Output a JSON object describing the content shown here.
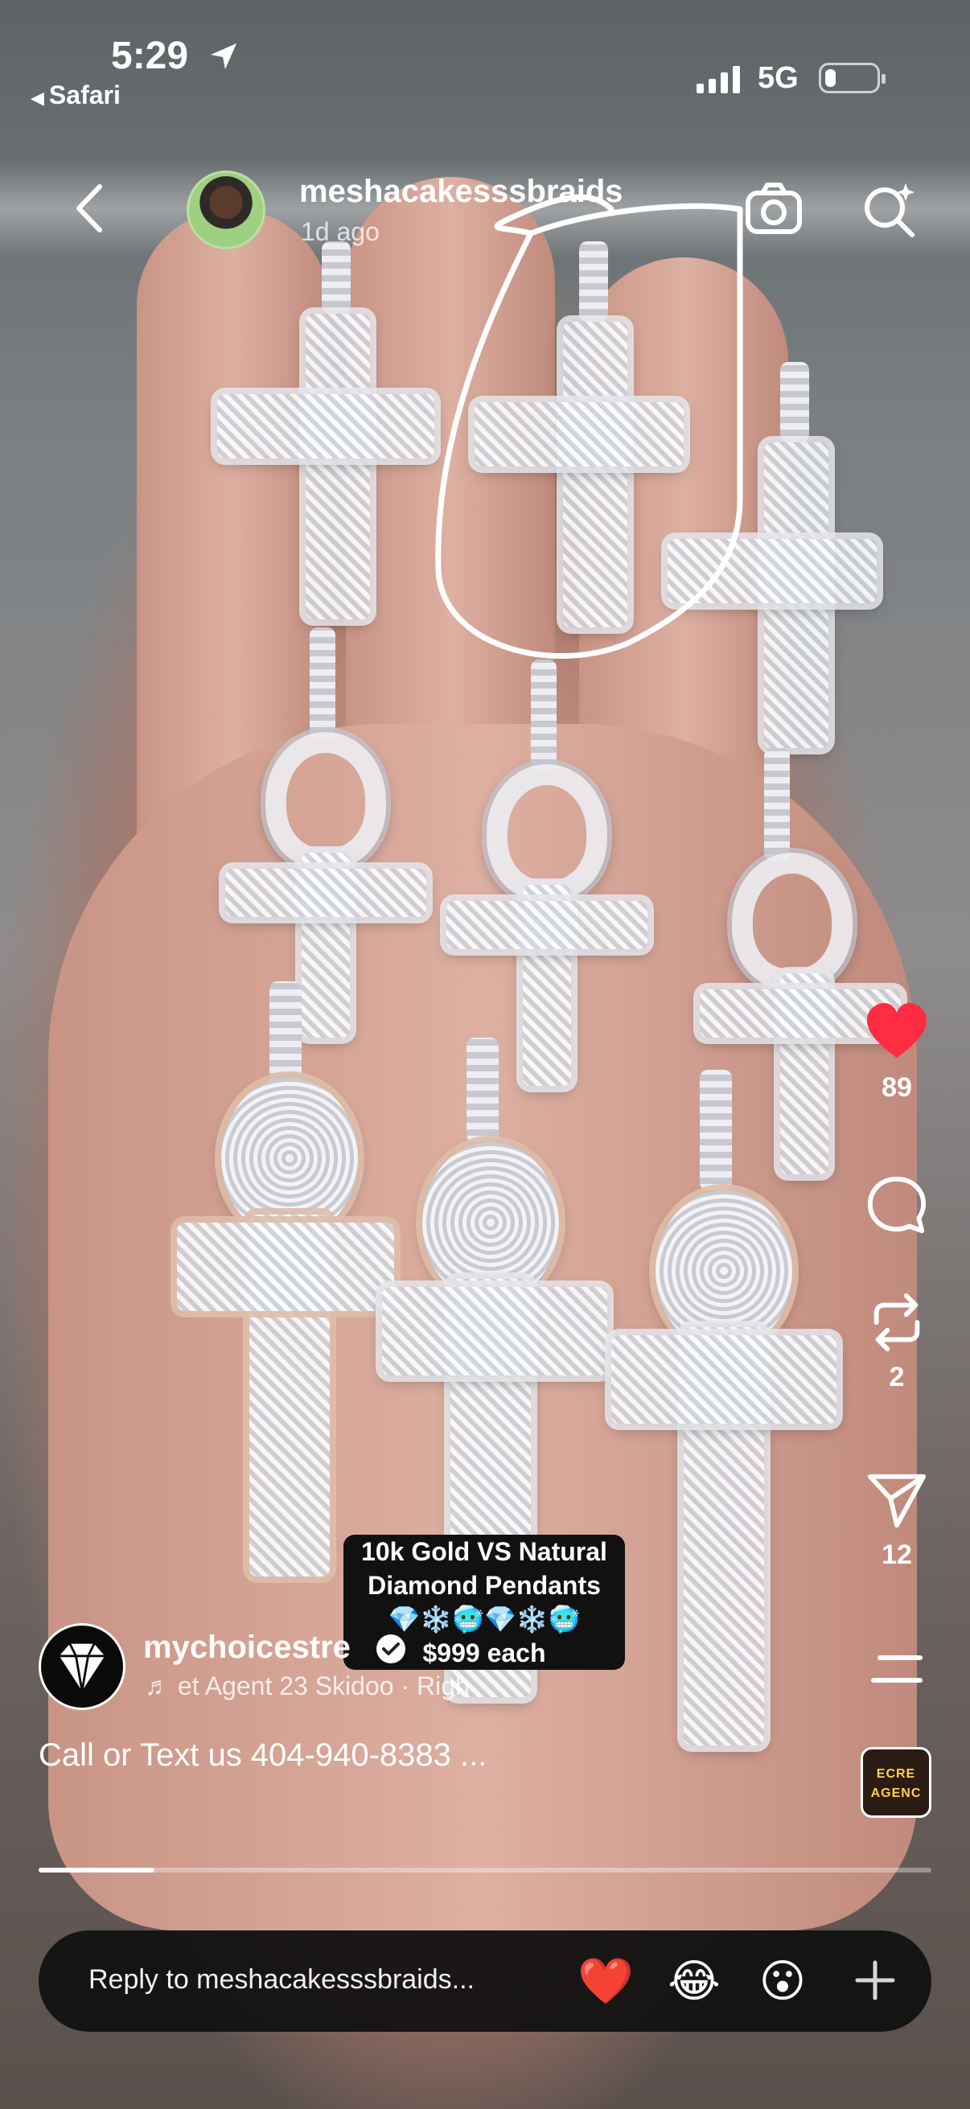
{
  "status_bar": {
    "time": "5:29",
    "back_app": "Safari",
    "network": "5G",
    "signal_bars": 4,
    "battery_level": 0.2
  },
  "story": {
    "username": "meshacakesssbraids",
    "time_ago": "1d ago"
  },
  "post": {
    "author": "mychoicestre",
    "music": "et Agent 23 Skidoo · Righ",
    "caption": "Call or Text us 404-940-8383 ...",
    "sticker_lines": [
      "10k Gold VS Natural",
      "Diamond Pendants",
      "💎❄️🥶💎❄️🥶",
      "$999 each"
    ],
    "audio_thumb_lines": [
      "ECRE",
      "AGENC"
    ]
  },
  "actions": {
    "like_count": "89",
    "repost_count": "2",
    "share_count": "12"
  },
  "progress": 0.13,
  "reply_bar": {
    "placeholder": "Reply to meshacakesssbraids...",
    "reactions": [
      "❤️",
      "😂",
      "😮"
    ]
  },
  "colors": {
    "like": "#ff2d43",
    "sticker_bg": "#111111",
    "reply_bg": "#0f0f0f"
  },
  "icons": [
    "location-arrow-icon",
    "back-chevron-icon",
    "camera-icon",
    "sparkle-search-icon",
    "heart-icon",
    "comment-icon",
    "repost-icon",
    "send-icon",
    "menu-icon",
    "music-note-icon",
    "verified-icon",
    "plus-icon"
  ]
}
